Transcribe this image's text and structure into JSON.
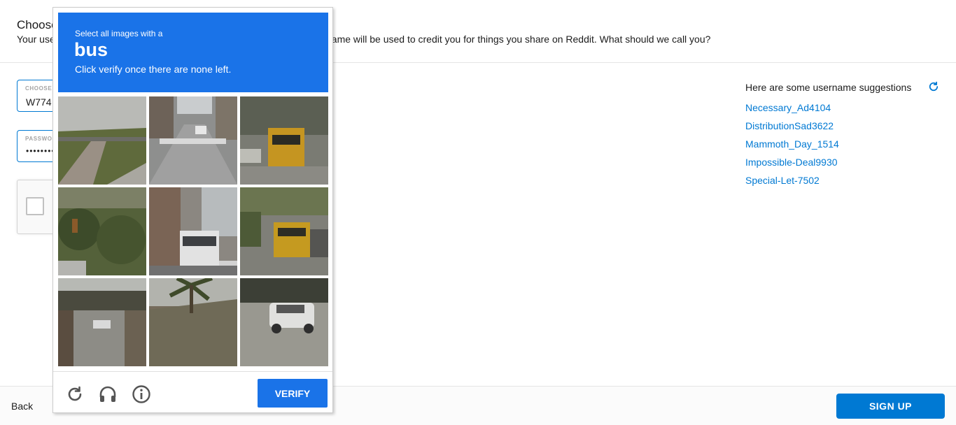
{
  "header": {
    "title": "Choose your username",
    "subtitle_left": "Your usernam",
    "subtitle_right": "name will be used to credit you for things you share on Reddit. What should we call you?"
  },
  "form": {
    "username": {
      "label": "CHOOSE",
      "value": "W774"
    },
    "password": {
      "label": "PASSWORD",
      "value": "••••••••"
    }
  },
  "suggestions": {
    "heading": "Here are some username suggestions",
    "items": [
      "Necessary_Ad4104",
      "DistributionSad3622",
      "Mammoth_Day_1514",
      "Impossible-Deal9930",
      "Special-Let-7502"
    ]
  },
  "footer": {
    "back_label": "Back",
    "signup_label": "SIGN UP"
  },
  "captcha": {
    "instruction_line1": "Select all images with a",
    "target": "bus",
    "instruction_line3": "Click verify once there are none left.",
    "verify_label": "VERIFY",
    "icons": [
      "reload-icon",
      "audio-icon",
      "info-icon"
    ],
    "tiles": [
      "road-grass",
      "crosswalk-street",
      "school-bus",
      "trees-traffic-light",
      "city-bus",
      "school-bus-street",
      "overpass-street",
      "palm-wall",
      "white-suv"
    ]
  },
  "colors": {
    "accent": "#0079d3",
    "captcha_blue": "#1a73e8"
  }
}
